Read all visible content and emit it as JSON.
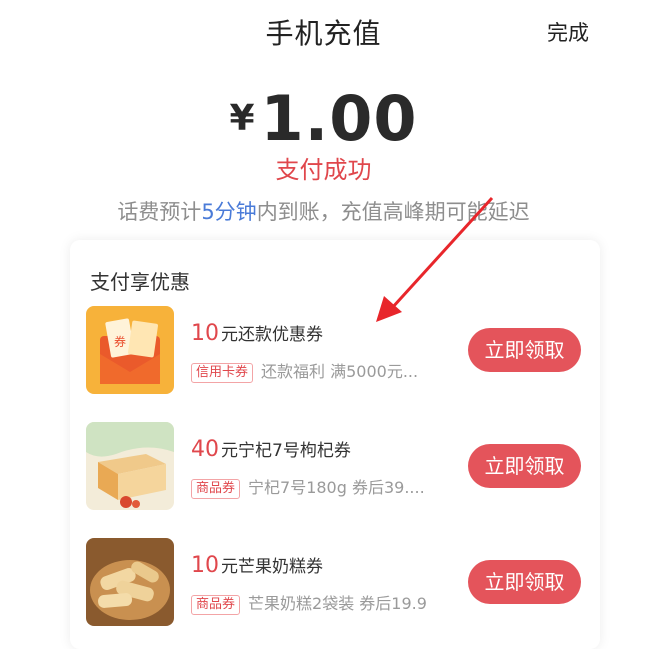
{
  "header": {
    "title": "手机充值",
    "done_label": "完成"
  },
  "payment": {
    "currency": "¥",
    "amount": "1.00",
    "status": "支付成功",
    "note_prefix": "话费预计",
    "note_highlight": "5分钟",
    "note_suffix": "内到账，充值高峰期可能延迟"
  },
  "offers": {
    "title": "支付享优惠",
    "items": [
      {
        "amount": "10",
        "text": "元还款优惠券",
        "tag": "信用卡券",
        "desc": "还款福利 满5000元...",
        "button": "立即领取"
      },
      {
        "amount": "40",
        "text": "元宁杞7号枸杞券",
        "tag": "商品券",
        "desc": "宁杞7号180g 券后39....",
        "button": "立即领取"
      },
      {
        "amount": "10",
        "text": "元芒果奶糕券",
        "tag": "商品券",
        "desc": "芒果奶糕2袋装 券后19.9",
        "button": "立即领取"
      }
    ]
  },
  "colors": {
    "accent": "#e0474c",
    "button": "#e4545b",
    "highlight": "#4a7bd8",
    "arrow": "#e8262b"
  },
  "icons": [
    "coupon-envelope-image",
    "goji-box-image",
    "mango-cake-image",
    "red-arrow-annotation"
  ]
}
